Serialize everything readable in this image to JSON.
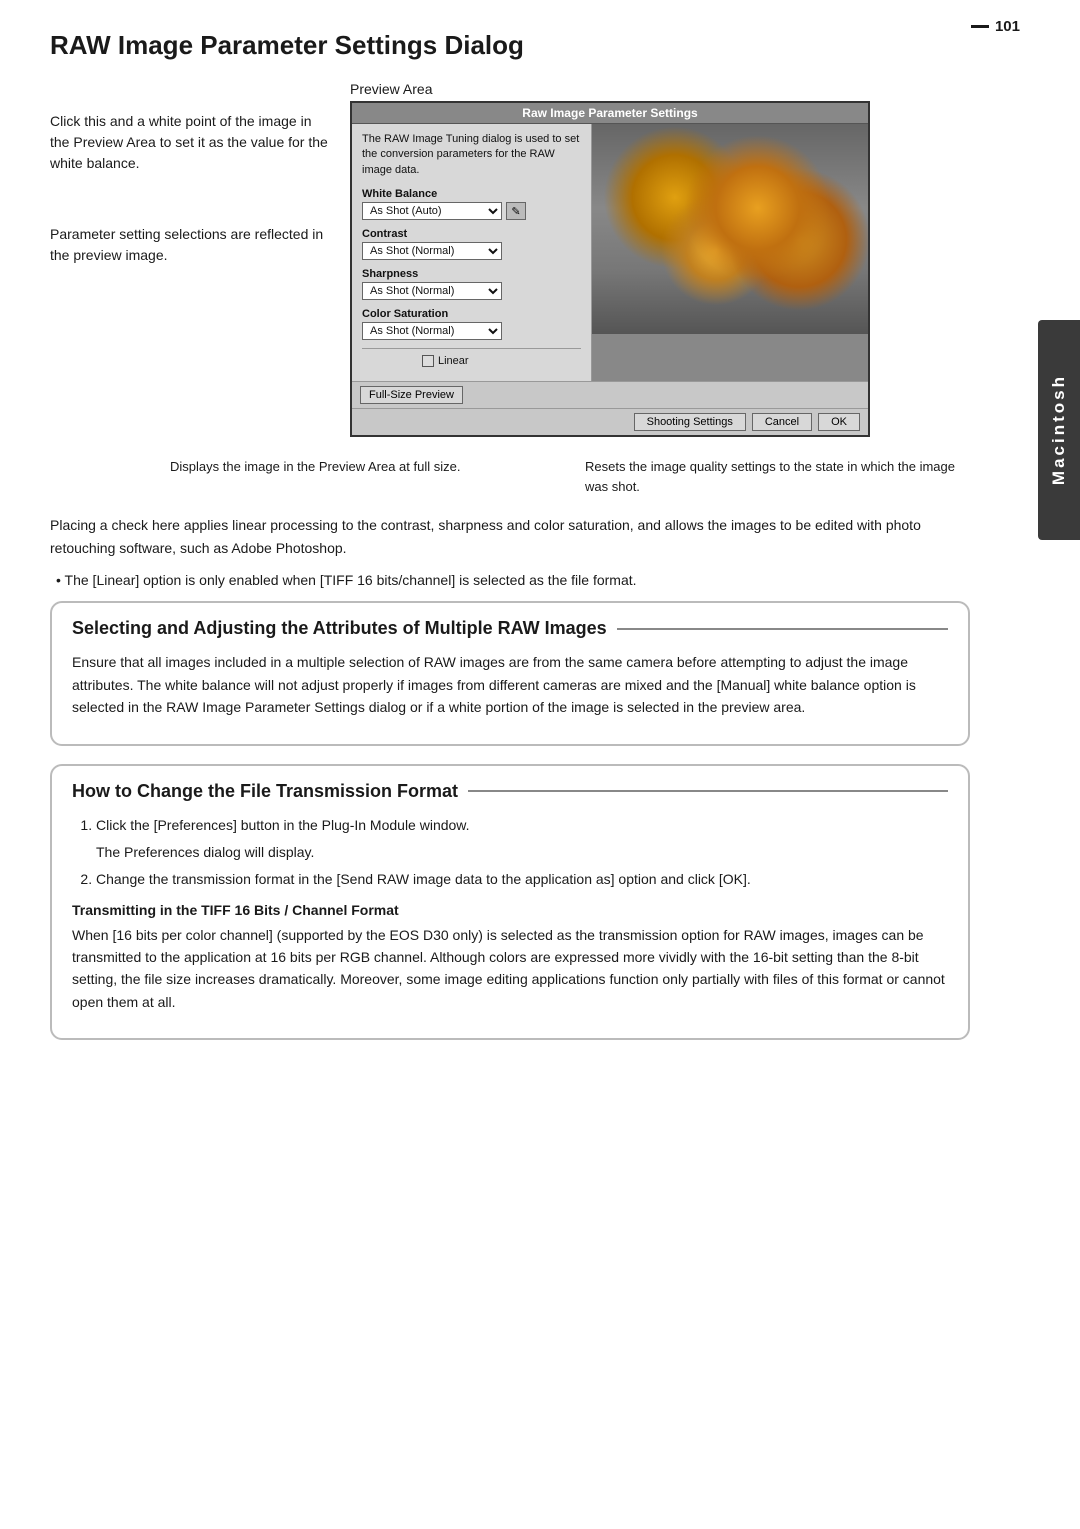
{
  "page": {
    "number": "101",
    "sidebar_label": "Macintosh"
  },
  "title": "RAW Image Parameter Settings Dialog",
  "annotations": {
    "white_balance_note": "Click this and a white point of the image in the Preview Area to set it as the value for the white balance.",
    "parameter_note": "Parameter setting selections are reflected in the preview image.",
    "preview_area_label": "Preview Area",
    "fullsize_note": "Displays the image in the Preview Area at full size.",
    "reset_note": "Resets the image quality settings to the state in which the image was shot."
  },
  "dialog": {
    "title": "Raw Image Parameter Settings",
    "info_text": "The RAW Image Tuning dialog is used to set the conversion parameters for the RAW image data.",
    "white_balance_label": "White Balance",
    "white_balance_value": "As Shot (Auto)",
    "contrast_label": "Contrast",
    "contrast_value": "As Shot (Normal)",
    "sharpness_label": "Sharpness",
    "sharpness_value": "As Shot (Normal)",
    "color_saturation_label": "Color Saturation",
    "color_saturation_value": "As Shot (Normal)",
    "linear_label": "Linear",
    "fullsize_btn": "Full-Size Preview",
    "shooting_settings_btn": "Shooting Settings",
    "cancel_btn": "Cancel",
    "ok_btn": "OK"
  },
  "body_text": {
    "linear_description": "Placing a check here applies linear processing to the contrast, sharpness and color saturation, and allows the images to be edited with photo retouching software, such as Adobe Photoshop.",
    "linear_note": "• The [Linear] option is only enabled when [TIFF 16 bits/channel] is selected as the file format."
  },
  "multiple_raw_section": {
    "title": "Selecting and Adjusting the Attributes of Multiple RAW Images",
    "body": "Ensure that all images included in a multiple selection of RAW images are from the same camera before attempting to adjust the image attributes. The white balance will not adjust properly if images from different cameras are mixed and the [Manual] white balance option is selected in the RAW Image Parameter Settings dialog or if a white portion of the image is selected in the preview area."
  },
  "file_transmission_section": {
    "title": "How to Change the File Transmission Format",
    "step1": "Click the [Preferences] button in the Plug-In Module window.",
    "step1_sub": "The Preferences dialog will display.",
    "step2": "Change the transmission format in the [Send RAW image data to the application as] option and click [OK].",
    "tiff_subtitle": "Transmitting in the TIFF 16 Bits / Channel Format",
    "tiff_body": "When [16 bits per color channel] (supported by the EOS D30 only) is selected as the transmission option for RAW images, images can be transmitted to the application at 16 bits per RGB channel. Although colors are expressed more vividly with the 16-bit setting than the 8-bit setting, the file size increases dramatically. Moreover, some image editing applications function only partially with files of this format or cannot open them at all."
  }
}
